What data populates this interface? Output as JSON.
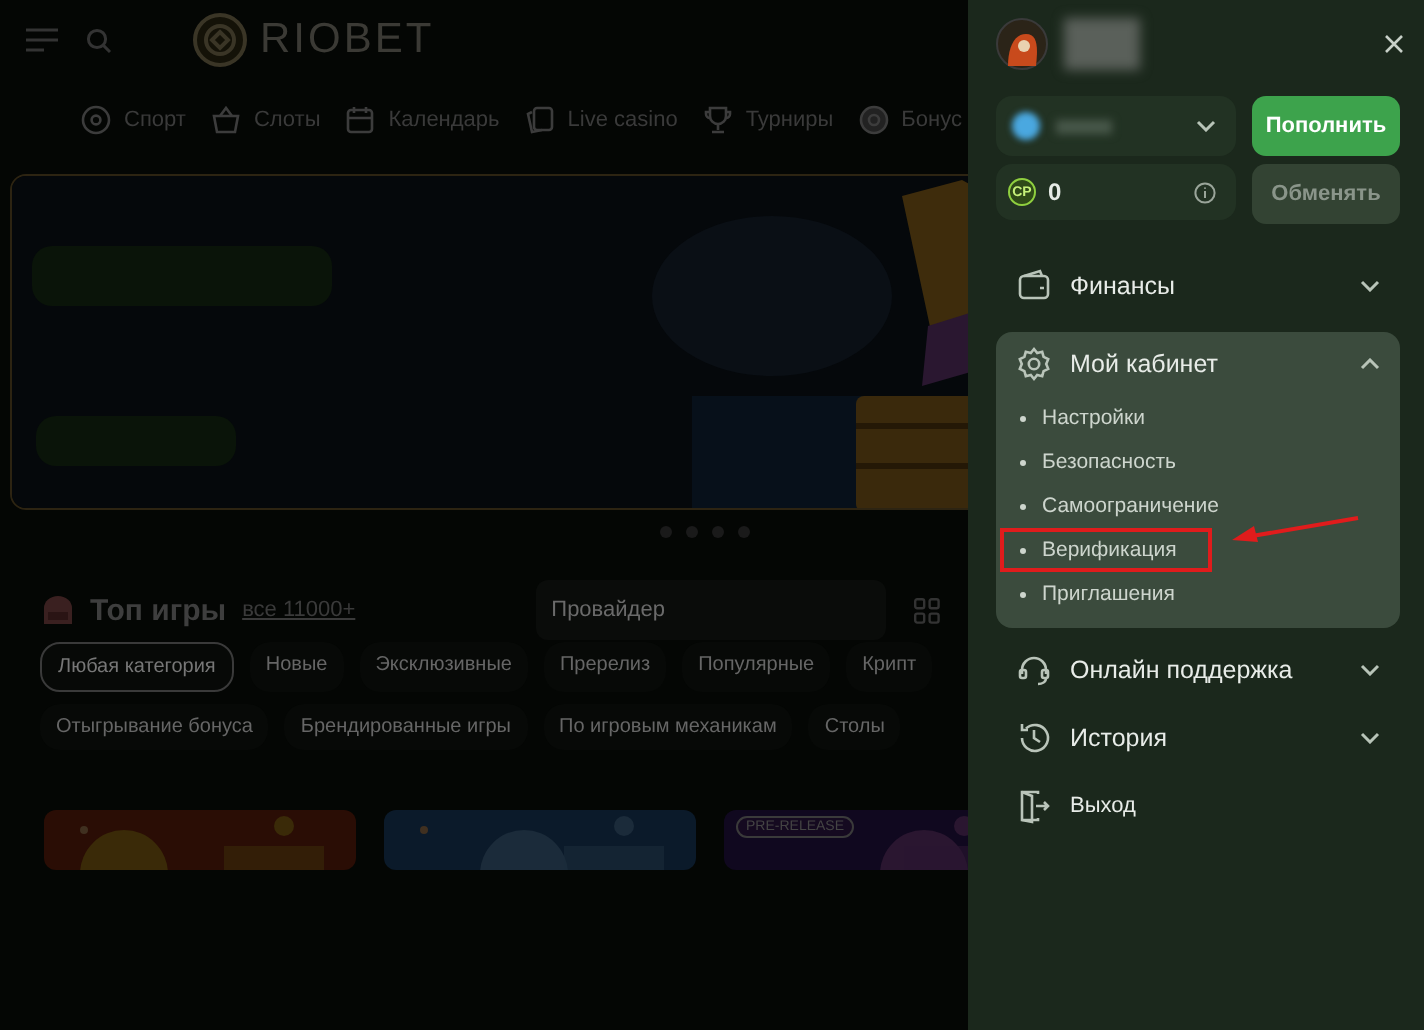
{
  "header": {
    "logo_text": "RIOBET"
  },
  "nav": [
    {
      "label": "Спорт",
      "kind": "ball"
    },
    {
      "label": "Слоты",
      "kind": "basket"
    },
    {
      "label": "Календарь",
      "kind": "calendar"
    },
    {
      "label": "Live casino",
      "kind": "cards"
    },
    {
      "label": "Турниры",
      "kind": "trophy"
    },
    {
      "label": "Бонус",
      "kind": "coin"
    }
  ],
  "banner": {
    "dots": [
      {
        "selected": false
      },
      {
        "selected": false
      },
      {
        "selected": false
      },
      {
        "selected": false
      }
    ]
  },
  "games": {
    "title": "Топ игры",
    "all_link": "все 11000+",
    "provider_placeholder": "Провайдер",
    "category_rows": [
      [
        {
          "label": "Любая категория",
          "selected": true
        },
        {
          "label": "Новые",
          "selected": false
        },
        {
          "label": "Эксклюзивные",
          "selected": false
        },
        {
          "label": "Пререлиз",
          "selected": false
        },
        {
          "label": "Популярные",
          "selected": false
        },
        {
          "label": "Крипт",
          "selected": false
        }
      ],
      [
        {
          "label": "Отыгрывание бонуса",
          "selected": false
        },
        {
          "label": "Брендированные игры",
          "selected": false
        },
        {
          "label": "По игровым механикам",
          "selected": false
        },
        {
          "label": "Столы",
          "selected": false
        }
      ]
    ],
    "tiles": [
      {
        "kind": "picture"
      },
      {
        "kind": "picture"
      },
      {
        "kind": "picture",
        "badge": "PRE-RELEASE"
      }
    ]
  },
  "panel": {
    "deposit_button": "Пополнить",
    "points": {
      "badge": "CP",
      "value": "0"
    },
    "exchange_button": {
      "label": "Обменять",
      "disabled": true
    },
    "menu": [
      {
        "label": "Финансы",
        "kind": "wallet",
        "expanded": false
      },
      {
        "label": "Мой кабинет",
        "kind": "gear",
        "expanded": true,
        "children": [
          {
            "label": "Настройки",
            "highlighted": false
          },
          {
            "label": "Безопасность",
            "highlighted": false
          },
          {
            "label": "Самоограничение",
            "highlighted": false
          },
          {
            "label": "Верификация",
            "highlighted": true
          },
          {
            "label": "Приглашения",
            "highlighted": false
          }
        ]
      },
      {
        "label": "Онлайн поддержка",
        "kind": "headset",
        "expanded": false
      },
      {
        "label": "История",
        "kind": "clock",
        "expanded": false
      },
      {
        "label": "Выход",
        "kind": "exit"
      }
    ]
  }
}
